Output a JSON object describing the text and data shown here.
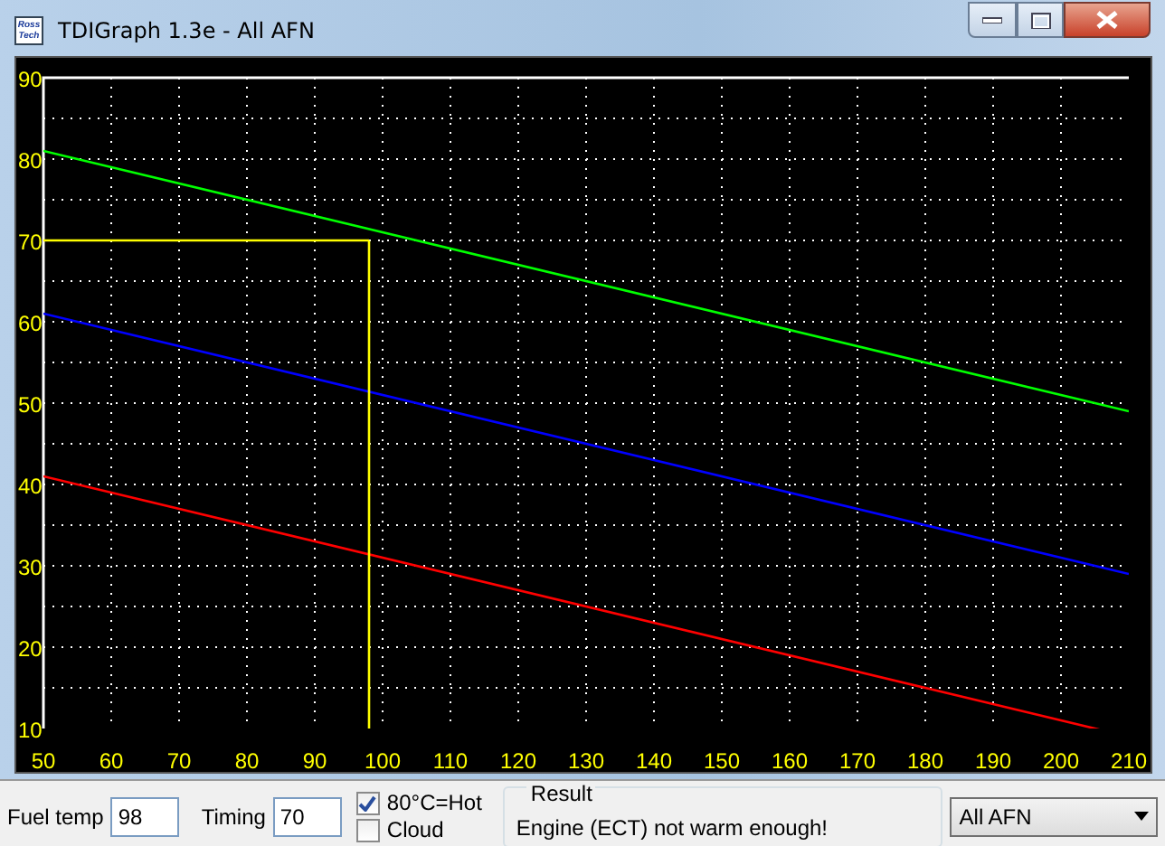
{
  "window": {
    "title": "TDIGraph 1.3e - All AFN",
    "logo_lines": [
      "Ross",
      "Tech"
    ]
  },
  "chart": {
    "chart_data": {
      "type": "line",
      "x": [
        50,
        205,
        210
      ],
      "grid": true,
      "series": [
        {
          "color": "#00ff00",
          "values": [
            81,
            50,
            49
          ]
        },
        {
          "color": "#0000ff",
          "values": [
            61,
            30,
            29
          ]
        },
        {
          "color": "#ff0000",
          "values": [
            41,
            10,
            null
          ]
        }
      ],
      "xlim": [
        50,
        210
      ],
      "ylim": [
        10,
        90
      ],
      "xticks": [
        50,
        60,
        70,
        80,
        90,
        100,
        110,
        120,
        130,
        140,
        150,
        160,
        170,
        180,
        190,
        200,
        210
      ],
      "yticks": [
        10,
        20,
        30,
        40,
        50,
        60,
        70,
        80,
        90
      ],
      "ref_lines": [
        {
          "axis": "x",
          "value": 98,
          "color": "#ffff00"
        },
        {
          "axis": "y",
          "value": 70,
          "color": "#ffff00"
        }
      ]
    }
  },
  "controls": {
    "fuel_temp": {
      "label": "Fuel temp",
      "value": "98"
    },
    "timing": {
      "label": "Timing",
      "value": "70"
    },
    "checkboxes": [
      {
        "label": "80°C=Hot",
        "checked": true
      },
      {
        "label": "Cloud",
        "checked": false
      }
    ],
    "result": {
      "legend": "Result",
      "text": "Engine (ECT) not warm enough!"
    },
    "mode_select": {
      "value": "All AFN"
    }
  }
}
